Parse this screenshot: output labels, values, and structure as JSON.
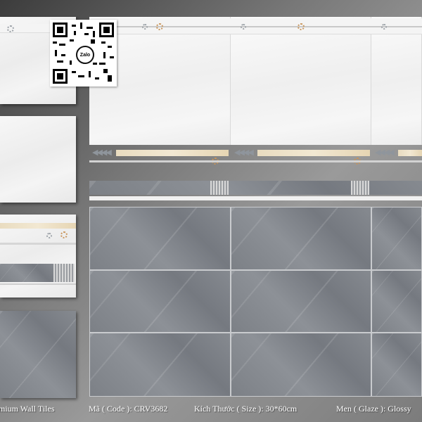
{
  "footer": {
    "series": "mium Wall Tiles",
    "code": "Mã ( Code ): CRV3682",
    "size": "Kích Thước ( Size ): 30*60cm",
    "glaze": "Men ( Glaze ): Glossy"
  },
  "qr": {
    "badge": "Zalo",
    "icon": "qr-code"
  },
  "colors": {
    "white_tile": "#f2f2f2",
    "grey_tile": "#83878d",
    "gold_strip": "#ecdfc3",
    "background": "#7c7c7c"
  }
}
